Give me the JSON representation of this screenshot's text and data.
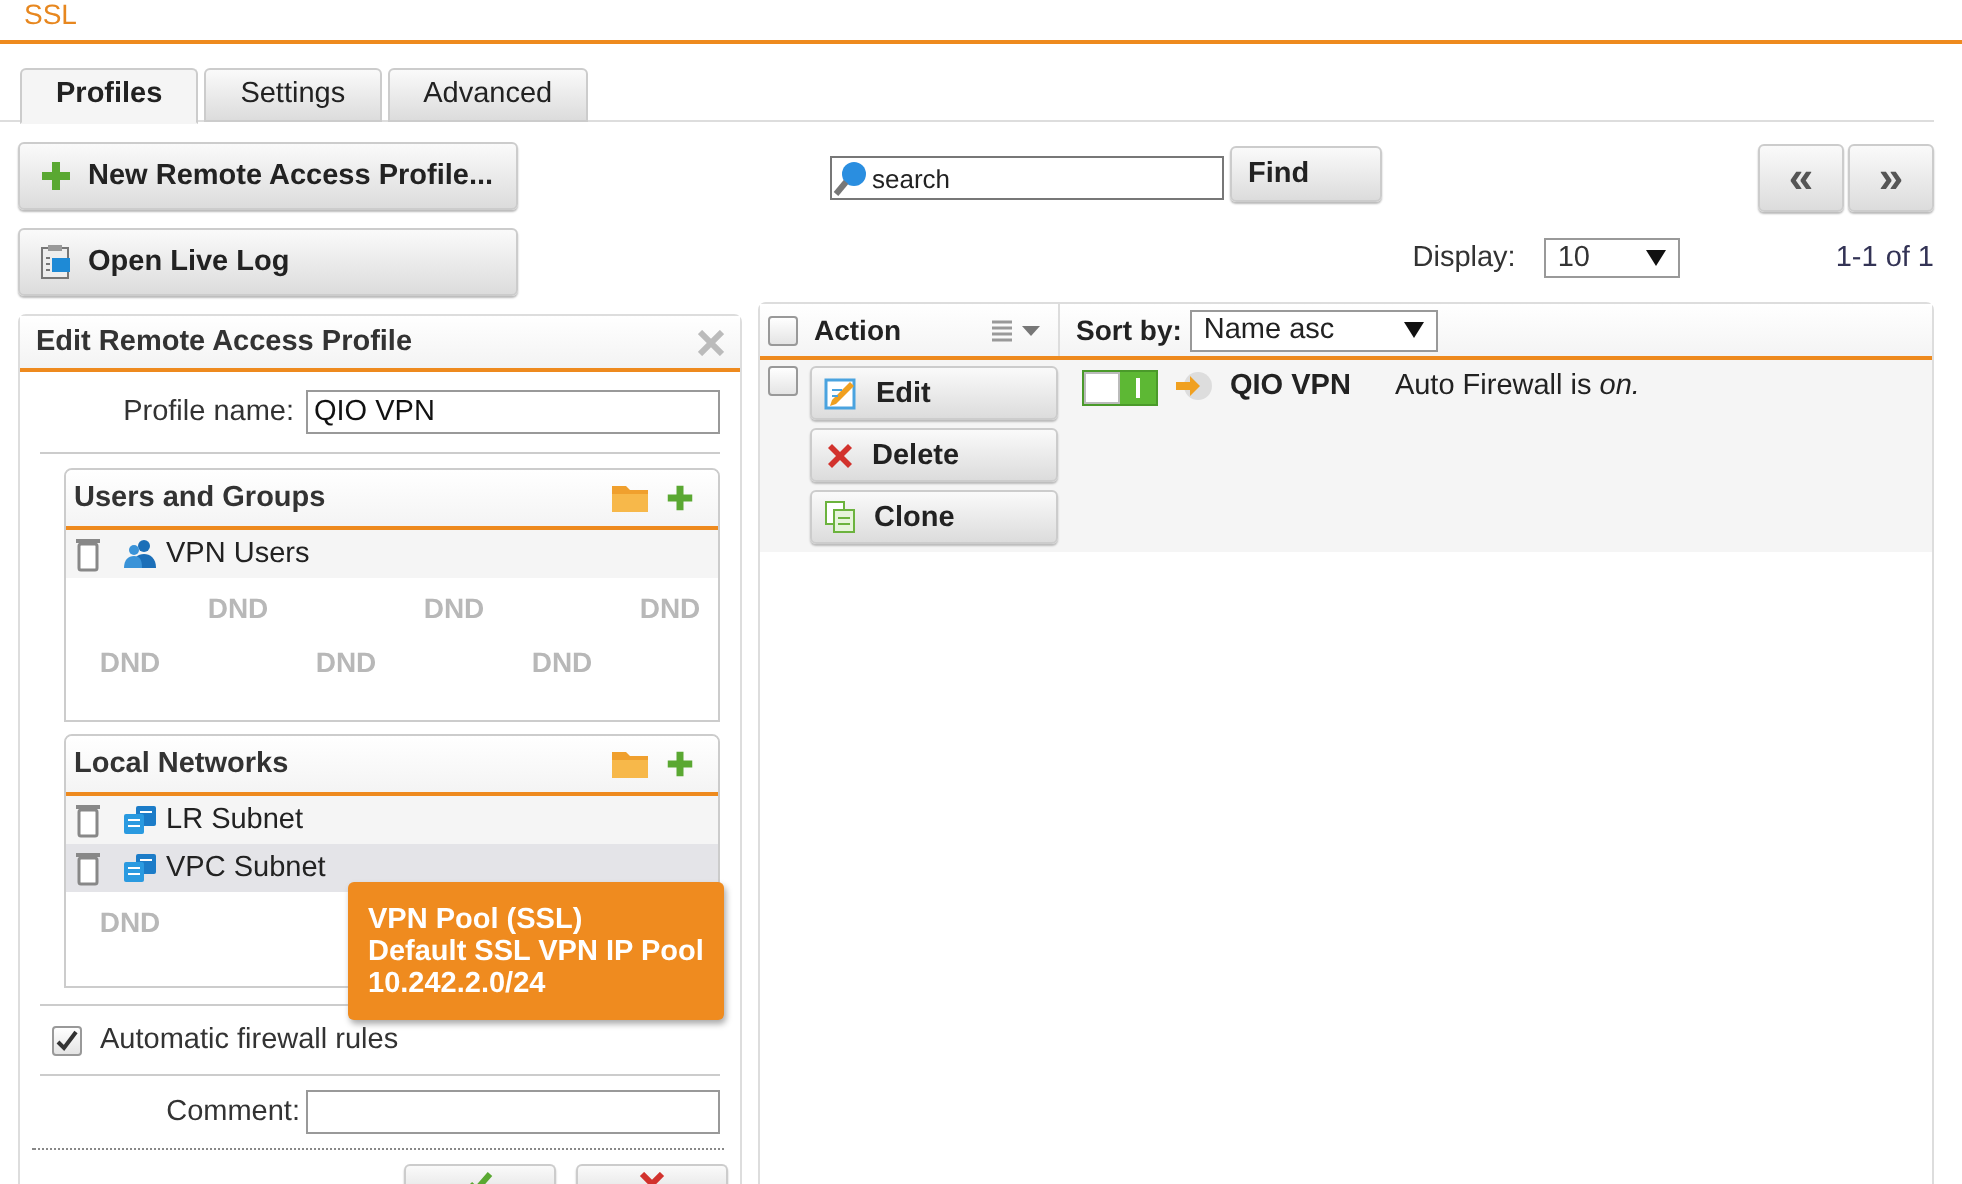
{
  "header": {
    "title": "SSL"
  },
  "tabs": [
    {
      "label": "Profiles",
      "selected": true
    },
    {
      "label": "Settings",
      "selected": false
    },
    {
      "label": "Advanced",
      "selected": false
    }
  ],
  "toolbar_buttons": [
    {
      "label": "New Remote Access Profile...",
      "kind": "add"
    },
    {
      "label": "Open Live Log",
      "kind": "log"
    }
  ],
  "search": {
    "placeholder": "search"
  },
  "find_button": "Find",
  "pager": {
    "prev": "«",
    "next": "»",
    "display_label": "Display:",
    "display_value": "10",
    "range": "1-1 of 1"
  },
  "edit_panel": {
    "title": "Edit Remote Access Profile",
    "profile_name_label": "Profile name:",
    "profile_name": "QIO VPN",
    "boxes": [
      {
        "title": "Users and Groups",
        "items": [
          {
            "label": "VPN Users",
            "kind": "group",
            "highlighted": false
          }
        ],
        "watermarks": [
          "DND",
          "DND",
          "DND",
          "DND",
          "DND",
          "DND"
        ]
      },
      {
        "title": "Local Networks",
        "items": [
          {
            "label": "LR Subnet",
            "kind": "network",
            "highlighted": false
          },
          {
            "label": "VPC Subnet",
            "kind": "network",
            "highlighted": true
          }
        ],
        "watermarks": [
          "DND"
        ]
      }
    ],
    "auto_firewall": {
      "label": "Automatic firewall rules",
      "checked": true
    },
    "comment_label": "Comment:",
    "bottom_buttons": [
      {
        "kind": "save"
      },
      {
        "kind": "cancel"
      }
    ]
  },
  "tooltip": {
    "lines": [
      "VPN Pool (SSL)",
      "Default SSL VPN IP Pool",
      "10.242.2.0/24"
    ]
  },
  "table": {
    "select_all_checked": false,
    "action_header": "Action",
    "sort_label": "Sort by:",
    "sort_value": "Name asc",
    "rows": [
      {
        "checked": false,
        "enabled": true,
        "name": "QIO VPN",
        "description": "Auto Firewall is *on.*",
        "actions": [
          {
            "label": "Edit",
            "kind": "edit"
          },
          {
            "label": "Delete",
            "kind": "delete"
          },
          {
            "label": "Clone",
            "kind": "clone"
          }
        ]
      }
    ]
  }
}
